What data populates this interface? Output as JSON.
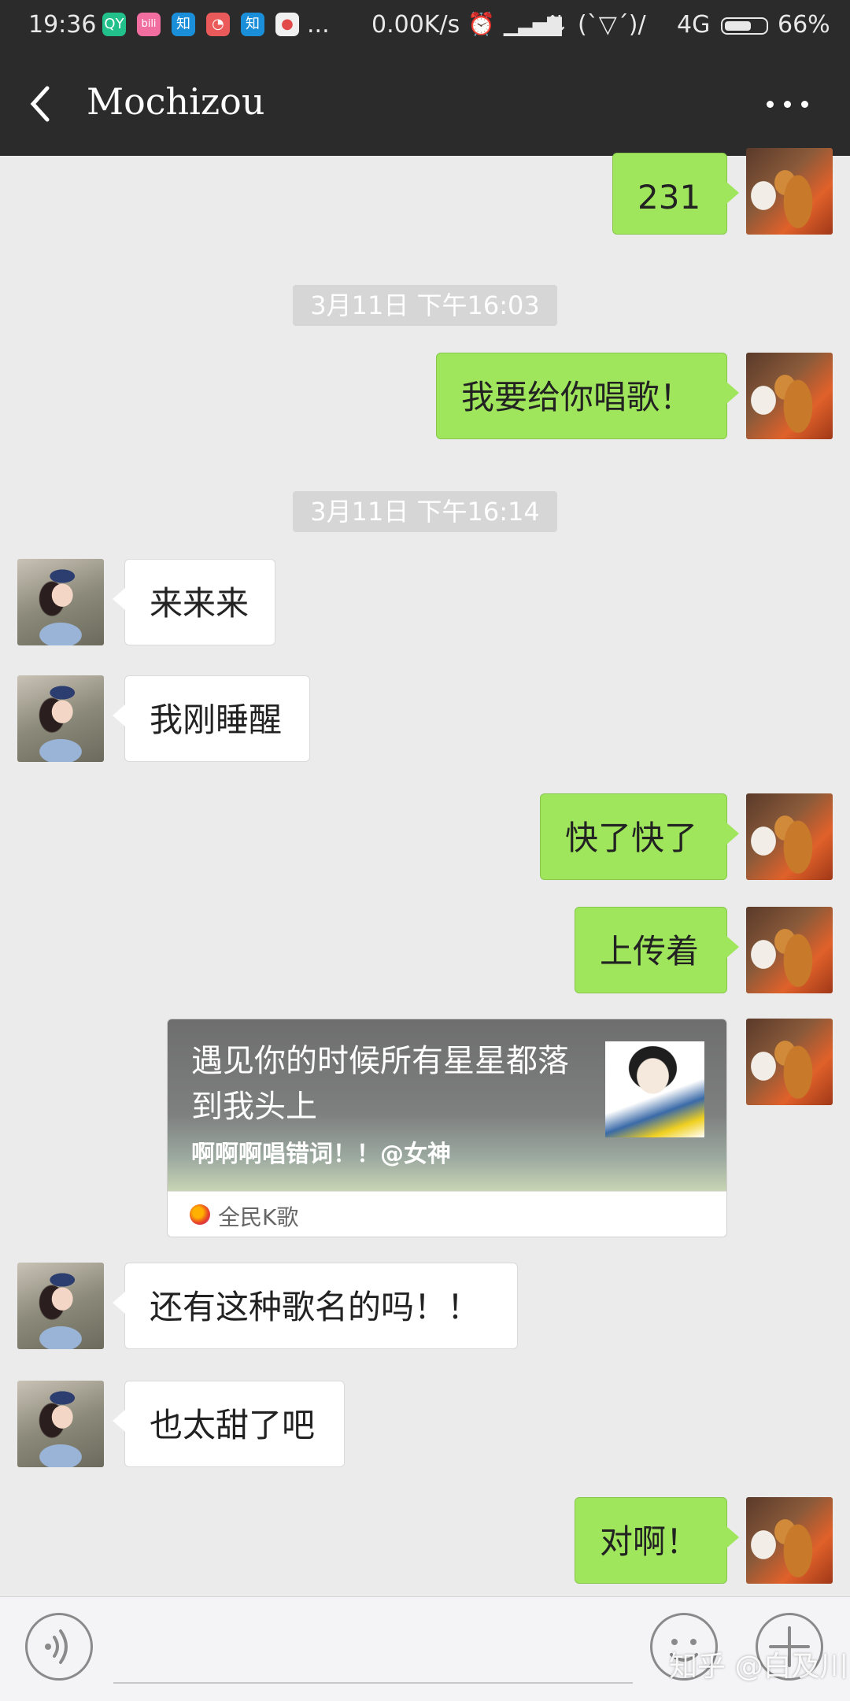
{
  "status_bar": {
    "time": "19:36",
    "app_icons": [
      {
        "name": "iqiyi-icon",
        "label": "QY",
        "color": "#22c08a"
      },
      {
        "name": "bilibili-icon",
        "label": "bili",
        "color": "#f26ea0"
      },
      {
        "name": "zhihu-icon",
        "label": "知",
        "color": "#1a8ed8"
      },
      {
        "name": "weibo-icon",
        "label": "◔",
        "color": "#ea5a5a"
      },
      {
        "name": "zhihu-icon-2",
        "label": "知",
        "color": "#1a8ed8"
      },
      {
        "name": "dots-app-icon",
        "label": "●",
        "color": "#f0f0f0"
      }
    ],
    "more": "...",
    "speed": "0.00K/s",
    "alarm": "⏰",
    "signal": "▁▃▅▇",
    "kaomoji": "(ˋ▽ˊ)/",
    "network": "4G",
    "battery_percent": "66%",
    "battery_level": 0.66
  },
  "header": {
    "title": "Mochizou"
  },
  "messages": [
    {
      "side": "right",
      "text": "231"
    },
    {
      "type": "timestamp",
      "text": "3月11日 下午16:03"
    },
    {
      "side": "right",
      "text": "我要给你唱歌！"
    },
    {
      "type": "timestamp",
      "text": "3月11日 下午16:14"
    },
    {
      "side": "left",
      "text": "来来来"
    },
    {
      "side": "left",
      "text": "我刚睡醒"
    },
    {
      "side": "right",
      "text": "快了快了"
    },
    {
      "side": "right",
      "text": "上传着"
    },
    {
      "side": "right",
      "type": "card",
      "title": "遇见你的时候所有星星都落到我头上",
      "subtitle": "啊啊啊唱错词！！@女神",
      "source": "全民K歌"
    },
    {
      "side": "left",
      "text": "还有这种歌名的吗！！"
    },
    {
      "side": "left",
      "text": "也太甜了吧"
    },
    {
      "side": "right",
      "text": "对啊！"
    }
  ],
  "watermark": "知乎 @白及川"
}
